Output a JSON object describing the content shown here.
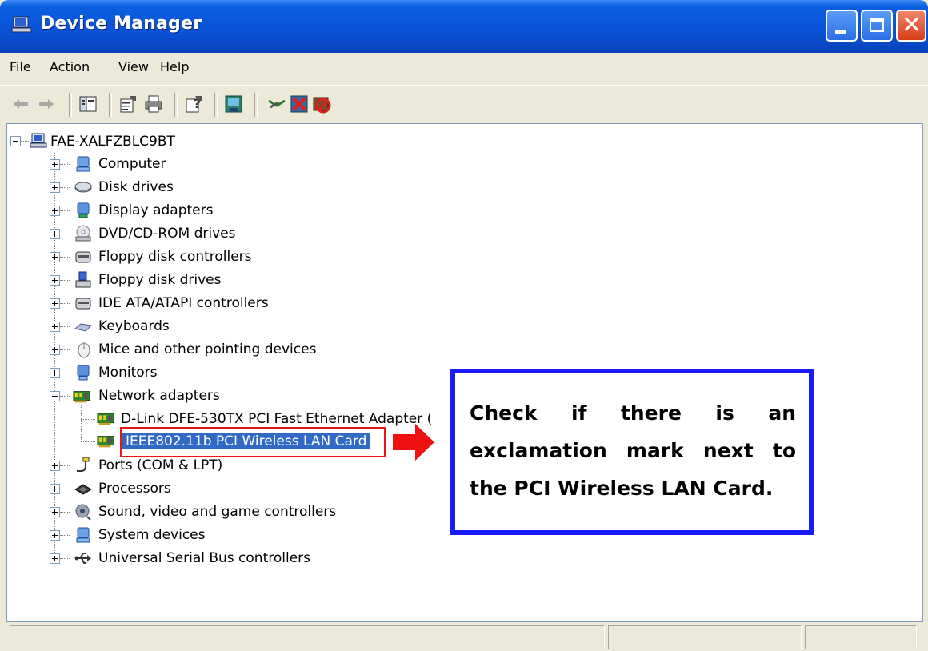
{
  "window": {
    "title": "Device Manager",
    "controls": {
      "minimize": "minimize-icon",
      "maximize": "maximize-icon",
      "close": "close-icon"
    }
  },
  "menu": [
    "File",
    "Action",
    "View",
    "Help"
  ],
  "toolbar": {
    "icons": [
      "back-icon",
      "forward-icon",
      "show-hide-console-tree-icon",
      "properties-icon",
      "print-icon",
      "help-icon",
      "scan-hardware-icon",
      "update-driver-icon",
      "uninstall-icon",
      "disable-icon"
    ]
  },
  "tree": {
    "root": "FAE-XALFZBLC9BT",
    "categories": [
      "Computer",
      "Disk drives",
      "Display adapters",
      "DVD/CD-ROM drives",
      "Floppy disk controllers",
      "Floppy disk drives",
      "IDE ATA/ATAPI controllers",
      "Keyboards",
      "Mice and other pointing devices",
      "Monitors",
      "Network adapters",
      "Ports (COM & LPT)",
      "Processors",
      "Sound, video and game controllers",
      "System devices",
      "Universal Serial Bus controllers"
    ],
    "network_children": [
      "D-Link DFE-530TX PCI Fast Ethernet Adapter (",
      "IEEE802.11b PCI Wireless LAN Card"
    ],
    "selected": "IEEE802.11b PCI Wireless LAN Card"
  },
  "callout": {
    "text": "Check if there is an exclamation mark next to the PCI Wireless LAN Card."
  },
  "colors": {
    "titlebar": "#0a52d6",
    "selection": "#316ac5",
    "callout_border": "#1a1aff",
    "highlight_box": "#e8151b"
  }
}
